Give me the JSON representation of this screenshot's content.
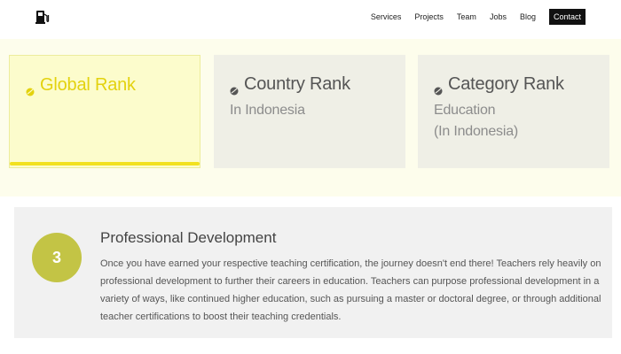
{
  "nav": {
    "items": [
      {
        "label": "Services"
      },
      {
        "label": "Projects"
      },
      {
        "label": "Team"
      },
      {
        "label": "Jobs"
      },
      {
        "label": "Blog"
      },
      {
        "label": "Contact"
      }
    ],
    "active": "Contact"
  },
  "logo_icon": "fuel-pump-icon",
  "ranks": {
    "global": {
      "title": "Global Rank",
      "progress": 1.0
    },
    "country": {
      "title": "Country Rank",
      "sub": "In Indonesia"
    },
    "category": {
      "title": "Category Rank",
      "sub": "Education",
      "sub2": "(In Indonesia)"
    }
  },
  "colors": {
    "accent_yellow": "#f2e11f",
    "step_circle": "#c3c445",
    "band_bg": "#fdfdec"
  },
  "step": {
    "number": "3",
    "title": "Professional Development",
    "text": "Once you have earned your respective teaching certification, the journey doesn't end there! Teachers rely heavily on professional development to further their careers in education. Teachers can purpose professional development in a variety of ways, like continued higher education, such as pursuing a master or doctoral degree, or through additional teacher certifications to boost their teaching credentials."
  }
}
